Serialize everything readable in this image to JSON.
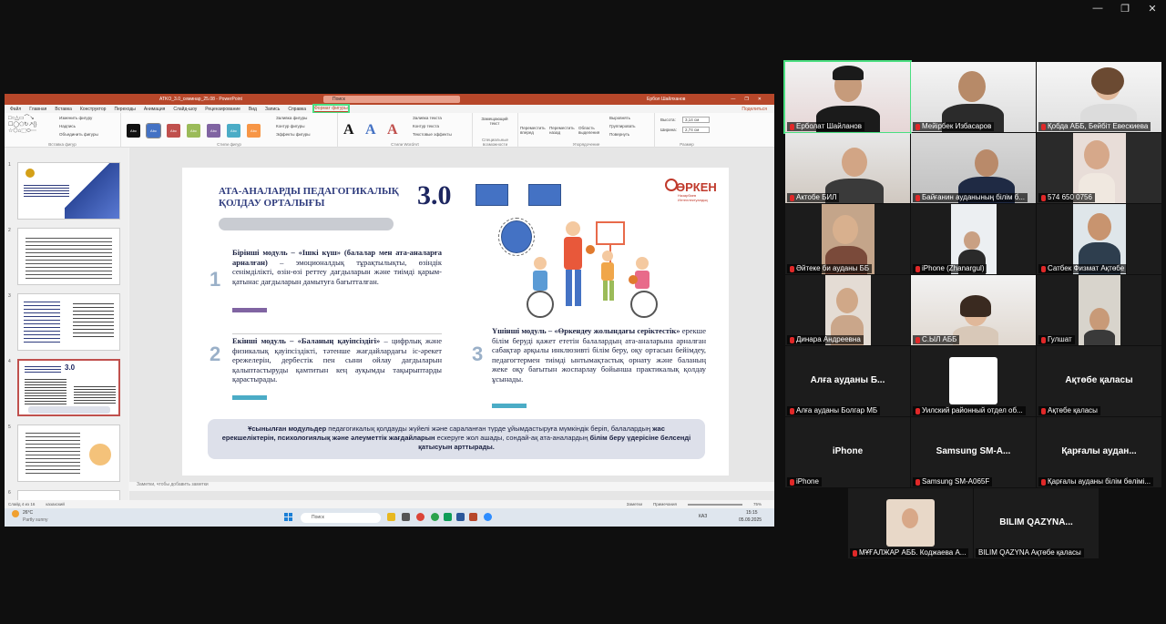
{
  "window_controls": [
    "—",
    "❐",
    "✕"
  ],
  "ppt": {
    "file_name": "ATKO_3.0_семинар_25.08 - PowerPoint",
    "search_placeholder": "Поиск",
    "user": "Ербол Шайлханов",
    "menu": [
      "Файл",
      "Главная",
      "Вставка",
      "Конструктор",
      "Переходы",
      "Анимация",
      "Слайд-шоу",
      "Рецензирование",
      "Вид",
      "Запись",
      "Справка",
      "Формат фигуры"
    ],
    "active_menu": "Формат фигуры",
    "share": "Поделиться",
    "ribbon_groups": [
      "Вставка фигур",
      "Стили фигур",
      "Стили WordArt",
      "Специальные возможности",
      "Упорядочение",
      "Размер"
    ],
    "ribbon_items": {
      "change_shape": "Изменить фигуру",
      "textbox": "Надпись",
      "merge": "Объединить фигуры",
      "fill": "Заливка фигуры",
      "outline": "Контур фигуры",
      "effects": "Эффекты фигуры",
      "text_fill": "Заливка текста",
      "text_outline": "Контур текста",
      "text_effects": "Текстовые эффекты",
      "alt_text": "Замещающий текст",
      "forward": "Переместить вперед",
      "backward": "Переместить назад",
      "selection": "Область выделения",
      "align": "Выровнять",
      "group": "Группировать",
      "rotate": "Повернуть",
      "height_label": "Высота:",
      "height_value": "3,14 см",
      "width_label": "Ширина:",
      "width_value": "2,74 см",
      "style_label": "Abc"
    },
    "notes": "Заметки, чтобы добавить заметки",
    "status_left": "Слайд 4 из 16",
    "status_lang": "казахский",
    "status_notes": "Заметки",
    "status_comments": "Примечания",
    "zoom": "75%",
    "taskbar": {
      "weather_temp": "26°C",
      "weather_desc": "Partly sunny",
      "search": "Поиск",
      "lang": "КАЗ",
      "time": "15:15",
      "date": "05.09.2025"
    }
  },
  "slide": {
    "title": "АТА-АНАЛАРДЫ ПЕДАГОГИКАЛЫҚ ҚОЛДАУ ОРТАЛЫҒЫ",
    "version": "3.0",
    "logo": "ӨРКЕН",
    "logo_sub": "Назарбаев Интеллектуалдық",
    "m1_num": "1",
    "m1_title": "Бірінші модуль – «Ішкі күш» (балалар мен ата-аналарға арналған)",
    "m1_text": " – эмоционалдық тұрақтылықты, өзіндік сенімділікті, өзін-өзі реттеу дағдыларын және тиімді қарым-қатынас дағдыларын дамытуға бағытталған.",
    "m2_num": "2",
    "m2_title": "Екінші модуль – «Баланың қауіпсіздігі»",
    "m2_text": " – цифрлық және физикалық қауіпсіздікті, тәтенше жағдайлардағы іс-әрекет ережелерін, дербестік пен сыни ойлау дағдыларын қалыптастыруды қамтитын кең ауқымды тақырыптарды қарастырады.",
    "m3_num": "3",
    "m3_title": "Үшінші модуль – «Өркендеу жолындағы серіктестік»",
    "m3_text": " ерекше білім беруді қажет ететін балалардың ата-аналарына арналған сабақтар арқылы инклюзивті білім беру, оқу ортасын бейімдеу, педагогтермен тиімді ынтымақтастық орнату және баланың жеке оқу бағытын жоспарлау бойынша практикалық қолдау ұсынады.",
    "summary_a": "Ұсынылған модульдер",
    "summary_b": " педагогикалық қолдауды жүйелі және сараланған түрде ұйымдастыруға мүмкіндік беріп, балалардың ",
    "summary_c": "жас ерекшеліктерін, психологиялық және әлеуметтік жағдайларын",
    "summary_d": " ескеруге жол ашады, сондай-ақ ата-аналардың ",
    "summary_e": "білім беру үдерісіне белсенді қатысуын арттырады."
  },
  "thumb_numbers": [
    "1",
    "2",
    "3",
    "4",
    "5",
    "6"
  ],
  "participants": [
    {
      "name": "Ерболат Шайланов",
      "mic_off": true
    },
    {
      "name": "Мейірбек Избасаров",
      "mic_off": true
    },
    {
      "name": "Қобда АББ, Бейбіт Евескиева",
      "mic_off": true
    },
    {
      "name": "Актобе БИЛ",
      "mic_off": true
    },
    {
      "name": "Байғанин ауданының білім б...",
      "mic_off": true
    },
    {
      "name": "574 650 0756",
      "mic_off": true
    },
    {
      "name": "Әйтеке би ауданы ББ",
      "mic_off": true
    },
    {
      "name": "iPhone (Zhanargul)",
      "mic_off": true
    },
    {
      "name": "Сатбек Физмат Ақтөбе",
      "mic_off": true
    },
    {
      "name": "Динара Андреевна",
      "mic_off": true
    },
    {
      "name": "С.ЫЛ АББ",
      "mic_off": true
    },
    {
      "name": "Гулшат",
      "mic_off": true
    }
  ],
  "no_video": [
    {
      "title": "Алға ауданы Б...",
      "name": "Алға ауданы Болгар МБ"
    },
    {
      "title": "",
      "name": "Уилский районный отдел об..."
    },
    {
      "title": "Ақтөбе қаласы",
      "name": "Ақтөбе қаласы"
    },
    {
      "title": "iPhone",
      "name": "iPhone"
    },
    {
      "title": "Samsung SM-A...",
      "name": "Samsung SM-A065F"
    },
    {
      "title": "Қарғалы аудан...",
      "name": "Қарғалы ауданы білім бөлімі..."
    },
    {
      "title": "",
      "name": "МҰҒАЛЖАР АББ. Коджаева А..."
    },
    {
      "title": "BILIM QAZYNA...",
      "name": "BILIM QAZYNA Ақтөбе қаласы"
    }
  ],
  "colors": {
    "accent": "#b7472a",
    "zoom_active": "#4ade80",
    "mic_off": "#e02828",
    "slide_navy": "#1e2761"
  }
}
